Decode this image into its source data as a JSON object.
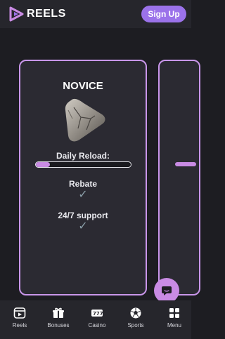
{
  "header": {
    "brand": "REELS",
    "signup_label": "Sign Up"
  },
  "colors": {
    "accent": "#9b72ea",
    "card_border": "#c996ea",
    "progress_fill": "#c98be4",
    "background": "#1d1d22"
  },
  "tier_card": {
    "title": "NOVICE",
    "image_icon": "stone-triangle-icon",
    "reload_label": "Daily Reload:",
    "reload_progress": 0.15,
    "perks": [
      {
        "label": "Rebate",
        "included": true
      },
      {
        "label": "24/7 support",
        "included": true
      }
    ]
  },
  "next_tier_card": {
    "reload_progress": 0.1
  },
  "chat": {
    "icon": "chat-bubble-icon"
  },
  "bottom_nav": {
    "items": [
      {
        "label": "Reels",
        "icon": "reels-icon"
      },
      {
        "label": "Bonuses",
        "icon": "gift-icon"
      },
      {
        "label": "Casino",
        "icon": "casino-icon"
      },
      {
        "label": "Sports",
        "icon": "soccer-ball-icon"
      },
      {
        "label": "Menu",
        "icon": "grid-menu-icon"
      }
    ]
  }
}
